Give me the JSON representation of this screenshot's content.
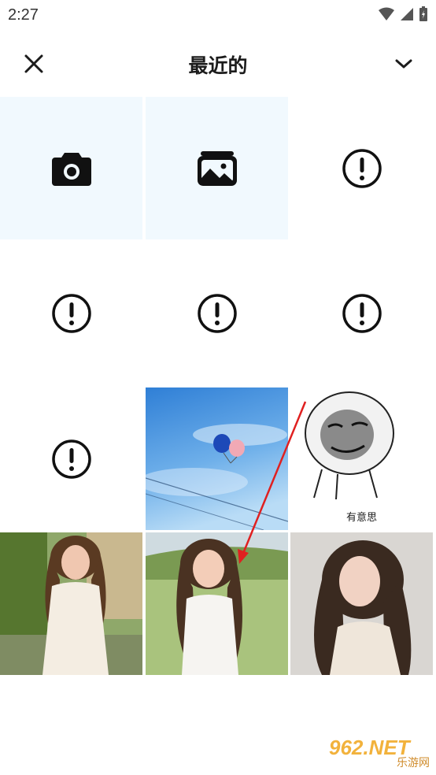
{
  "status": {
    "time": "2:27"
  },
  "header": {
    "title": "最近的"
  },
  "grid": {
    "meme_caption": "有意思"
  },
  "watermark": {
    "main": "962.NET",
    "sub": "乐游网"
  },
  "colors": {
    "tile_tint": "#f1f9fe",
    "icon": "#111111",
    "arrow": "#e02020"
  },
  "icons": [
    "close-icon",
    "chevron-down-icon",
    "camera-icon",
    "gallery-icon",
    "error-icon"
  ]
}
